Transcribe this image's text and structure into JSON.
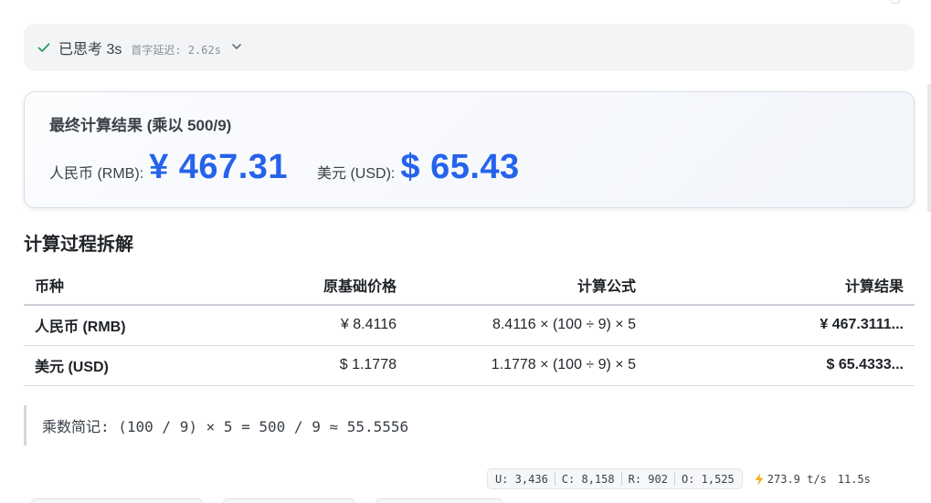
{
  "thinking": {
    "status": "已思考 3s",
    "latency": "首字延迟: 2.62s"
  },
  "result_card": {
    "title": "最终计算结果 (乘以 500/9)",
    "rmb_label": "人民币 (RMB):",
    "rmb_value": "¥ 467.31",
    "usd_label": "美元 (USD):",
    "usd_value": "$ 65.43"
  },
  "breakdown": {
    "heading": "计算过程拆解",
    "columns": [
      "币种",
      "原基础价格",
      "计算公式",
      "计算结果"
    ],
    "rows": [
      [
        "人民币 (RMB)",
        "¥ 8.4116",
        "8.4116 × (100 ÷ 9) × 5",
        "¥ 467.3111..."
      ],
      [
        "美元 (USD)",
        "$ 1.1778",
        "1.1778 × (100 ÷ 9) × 5",
        "$ 65.4333..."
      ]
    ]
  },
  "note": "乘数简记: (100 / 9) × 5 = 500 / 9 ≈ 55.5556",
  "stats": {
    "u": "U: 3,436",
    "c": "C: 8,158",
    "r": "R: 902",
    "o": "O: 1,525",
    "speed": "273.9 t/s",
    "duration": "11.5s"
  },
  "colors": {
    "accent": "#2563eb",
    "check": "#2e9e5b",
    "bolt": "#f2b01e"
  },
  "icons": {
    "check": "check-icon",
    "chevron": "chevron-down-icon",
    "bolt": "lightning-icon"
  }
}
